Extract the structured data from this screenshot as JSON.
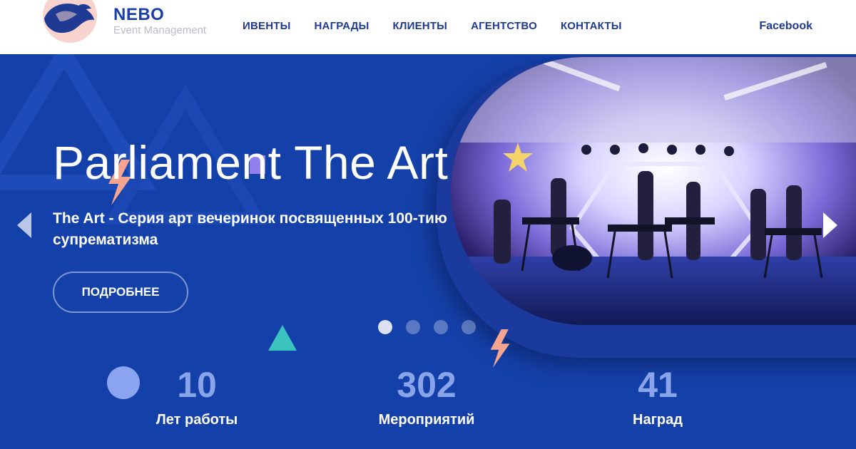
{
  "brand": {
    "name": "NEBO",
    "subtitle": "Event Management"
  },
  "nav": {
    "items": [
      "ИВЕНТЫ",
      "НАГРАДЫ",
      "КЛИЕНТЫ",
      "АГЕНТСТВО",
      "КОНТАКТЫ"
    ],
    "facebook": "Facebook"
  },
  "hero": {
    "title": "Parliament The Art",
    "description": "The Art - Серия арт вечеринок посвященных 100-тию супрематизма",
    "button": "ПОДРОБНЕЕ",
    "slides_total": 4,
    "active_slide": 1
  },
  "stats": [
    {
      "value": "10",
      "label": "Лет работы"
    },
    {
      "value": "302",
      "label": "Мероприятий"
    },
    {
      "value": "41",
      "label": "Наград"
    }
  ],
  "colors": {
    "brand": "#1f3a93",
    "hero_bg": "#1440a9",
    "stat_number": "#8aa4ea",
    "accent_coral": "#f4a48f",
    "accent_teal": "#3bc3c0",
    "accent_yellow": "#f5d36b",
    "accent_purple": "#a78bfa"
  },
  "icons": [
    "nebo-logo",
    "arrow-left-icon",
    "arrow-right-icon",
    "lightning-icon",
    "star-icon",
    "triangle-icon",
    "circle-icon"
  ]
}
